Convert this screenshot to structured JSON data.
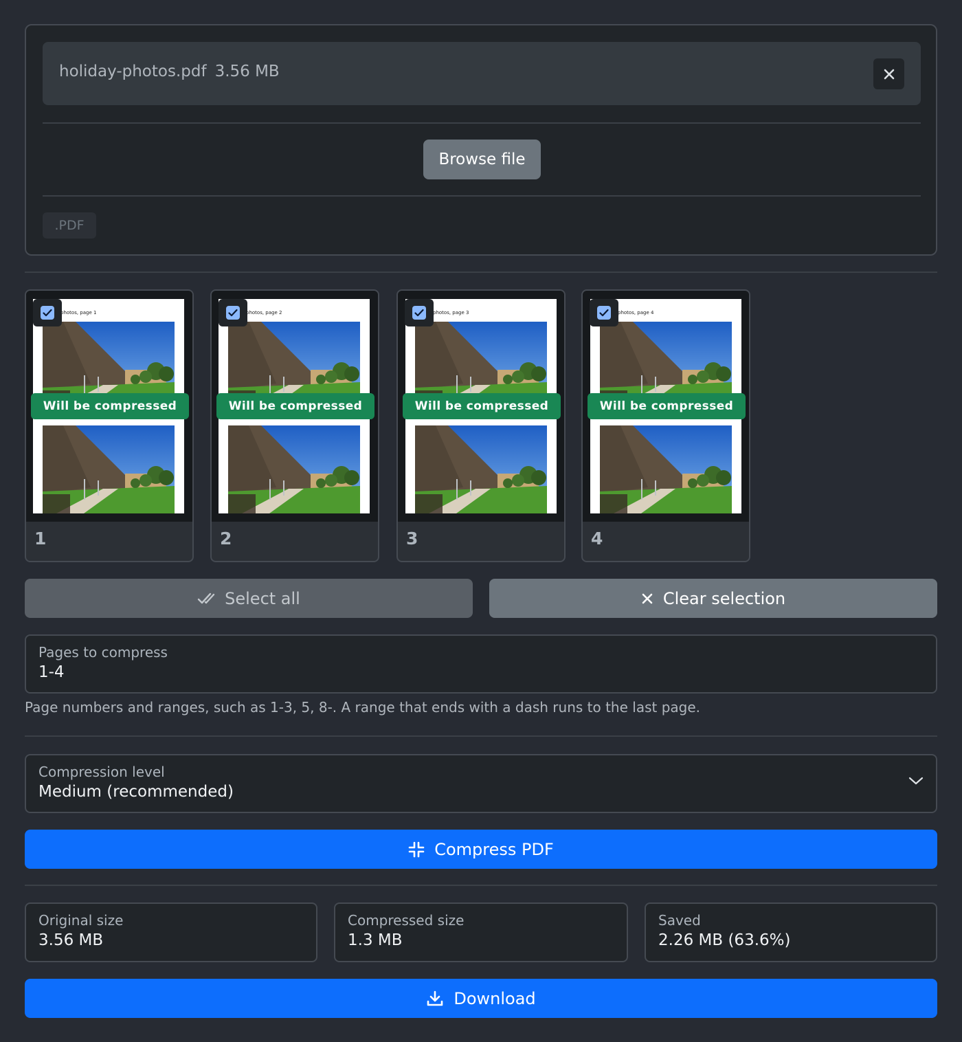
{
  "upload": {
    "file_name": "holiday-photos.pdf",
    "file_size": "3.56 MB",
    "browse_label": "Browse file",
    "accepted_type": ".PDF"
  },
  "pages": [
    {
      "number": "1",
      "caption": "photos, page 1",
      "status": "Will be compressed",
      "checked": true
    },
    {
      "number": "2",
      "caption": "photos, page 2",
      "status": "Will be compressed",
      "checked": true
    },
    {
      "number": "3",
      "caption": "photos, page 3",
      "status": "Will be compressed",
      "checked": true
    },
    {
      "number": "4",
      "caption": "photos, page 4",
      "status": "Will be compressed",
      "checked": true
    }
  ],
  "selection": {
    "select_all_label": "Select all",
    "clear_label": "Clear selection"
  },
  "pages_field": {
    "label": "Pages to compress",
    "value": "1-4",
    "help": "Page numbers and ranges, such as 1-3, 5, 8-. A range that ends with a dash runs to the last page."
  },
  "compression": {
    "label": "Compression level",
    "selected": "Medium (recommended)"
  },
  "compress_button": "Compress PDF",
  "results": {
    "original_label": "Original size",
    "original_value": "3.56 MB",
    "compressed_label": "Compressed size",
    "compressed_value": "1.3 MB",
    "saved_label": "Saved",
    "saved_value": "2.26 MB (63.6%)"
  },
  "download_button": "Download",
  "icons": {
    "close": "close-icon",
    "check": "check-icon",
    "select_all": "double-check-icon",
    "clear": "x-icon",
    "chevron": "chevron-down-icon",
    "compress": "compress-arrows-icon",
    "download": "download-icon"
  },
  "colors": {
    "background": "#272b33",
    "card": "#212529",
    "primary": "#0d6efd",
    "success": "#198754",
    "secondary": "#6c757d"
  }
}
